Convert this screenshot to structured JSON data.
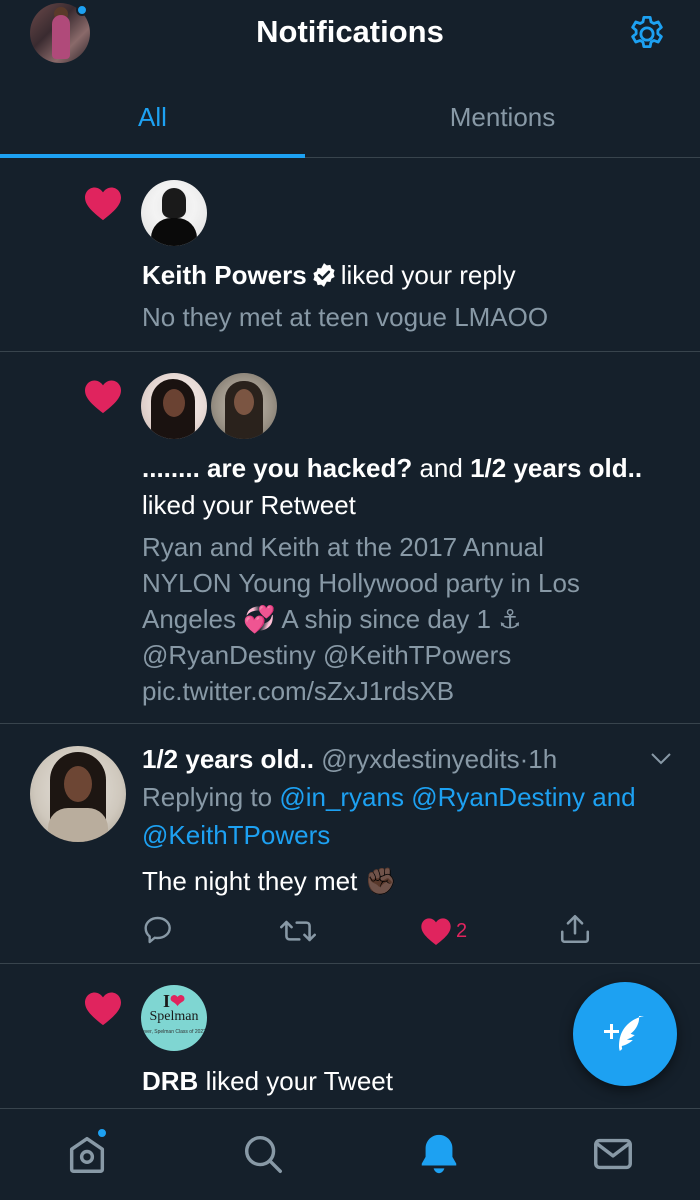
{
  "header": {
    "title": "Notifications",
    "settings_icon": "gear-icon",
    "profile_avatar": "profile-avatar"
  },
  "tabs": [
    {
      "label": "All",
      "active": true
    },
    {
      "label": "Mentions",
      "active": false
    }
  ],
  "colors": {
    "background": "#15202b",
    "accent": "#1da1f2",
    "like": "#e0245e",
    "muted": "#8899a6",
    "divider": "#38444d"
  },
  "notifications": [
    {
      "type": "like",
      "icon": "heart-icon",
      "actor": "Keith Powers",
      "verified": true,
      "action": "liked your reply",
      "snippet": "No they met at teen vogue LMAOO"
    },
    {
      "type": "like",
      "icon": "heart-icon",
      "actor1": "........ are you hacked?",
      "connector": "and",
      "actor2": "1/2 years old..",
      "action": "liked your Retweet",
      "snippet_lines": [
        "Ryan and Keith at the 2017 Annual",
        "NYLON Young Hollywood party in Los",
        "Angeles",
        "A ship since day 1",
        "@RyanDestiny @KeithTPowers",
        "pic.twitter.com/sZxJ1rdsXB"
      ],
      "emoji1": "💞",
      "emoji2": "⚓"
    },
    {
      "type": "reply",
      "name": "1/2 years old..",
      "handle": "@ryxdestinyedits",
      "separator": "·",
      "time": "1h",
      "replying_prefix": "Replying to",
      "replying_to1": "@in_ryans",
      "replying_to2": "@RyanDestiny",
      "replying_and": "and",
      "replying_to3": "@KeithTPowers",
      "text": "The night they met",
      "emoji": "✊🏿",
      "like_count": "2",
      "liked": true
    },
    {
      "type": "like",
      "icon": "heart-icon",
      "actor": "DRB",
      "action": "liked your Tweet",
      "avatar_text_i": "I",
      "avatar_text_word": "Spelman",
      "avatar_text_sub": "ever, Spelman Class of 2022"
    }
  ],
  "bottom_nav": [
    {
      "name": "home",
      "icon": "home-icon",
      "has_dot": true,
      "active": false
    },
    {
      "name": "search",
      "icon": "search-icon",
      "active": false
    },
    {
      "name": "notifications",
      "icon": "bell-icon",
      "active": true
    },
    {
      "name": "messages",
      "icon": "mail-icon",
      "active": false
    }
  ],
  "fab": {
    "icon": "compose-icon"
  }
}
